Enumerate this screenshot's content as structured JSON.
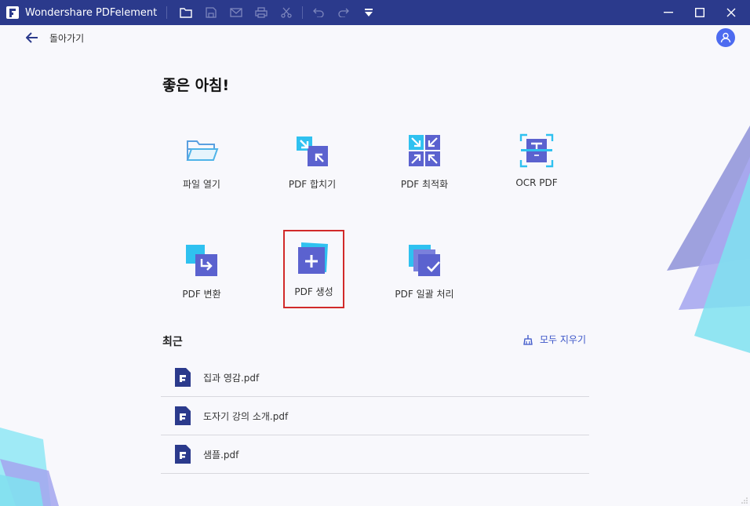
{
  "window": {
    "title": "Wondershare PDFelement"
  },
  "nav": {
    "back_label": "돌아가기"
  },
  "home": {
    "greeting": "좋은 아침!",
    "tiles": [
      {
        "label": "파일 열기",
        "icon": "folder-open-icon"
      },
      {
        "label": "PDF 합치기",
        "icon": "combine-pdf-icon"
      },
      {
        "label": "PDF 최적화",
        "icon": "optimize-pdf-icon"
      },
      {
        "label": "OCR PDF",
        "icon": "ocr-icon"
      },
      {
        "label": "PDF 변환",
        "icon": "convert-pdf-icon"
      },
      {
        "label": "PDF 생성",
        "icon": "create-pdf-icon"
      },
      {
        "label": "PDF 일괄 처리",
        "icon": "batch-process-icon"
      }
    ]
  },
  "recent": {
    "title": "최근",
    "clear_label": "모두 지우기",
    "files": [
      {
        "name": "집과 영감.pdf"
      },
      {
        "name": "도자기 강의 소개.pdf"
      },
      {
        "name": "샘플.pdf"
      }
    ]
  },
  "colors": {
    "titlebar": "#2b3a8c",
    "accent": "#3b55c8",
    "selection_border": "#d12a2a"
  }
}
